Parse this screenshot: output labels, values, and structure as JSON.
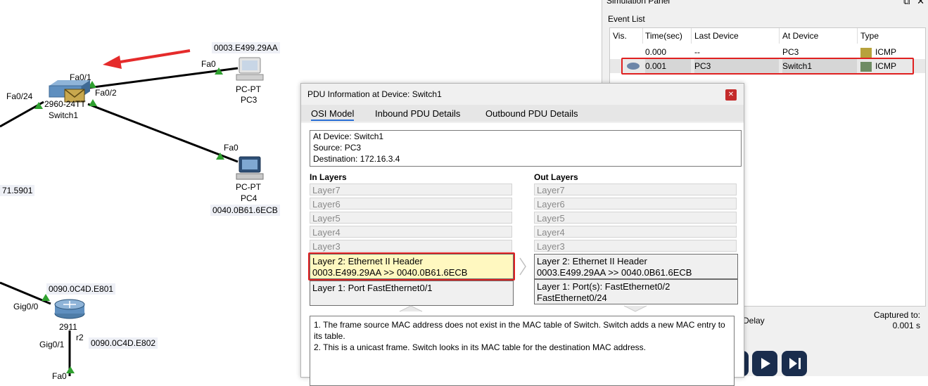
{
  "topology": {
    "mac_pc3": "0003.E499.29AA",
    "mac_pc4": "0040.0B61.6ECB",
    "mac_partial": "71.5901",
    "mac_router1": "0090.0C4D.E801",
    "mac_router2": "0090.0C4D.E802",
    "switch_name": "Switch1",
    "switch_model": "2960-24TT",
    "port_fa01": "Fa0/1",
    "port_fa02": "Fa0/2",
    "port_fa024": "Fa0/24",
    "pc3_type": "PC-PT",
    "pc3_name": "PC3",
    "pc3_port": "Fa0",
    "pc4_type": "PC-PT",
    "pc4_name": "PC4",
    "pc4_port": "Fa0",
    "router_model": "2911",
    "router_name_partial": "r2",
    "router_gig00": "Gig0/0",
    "router_gig01": "Gig0/1",
    "bottom_port_partial": "Fa0"
  },
  "simulation_panel": {
    "title": "Simulation Panel",
    "event_list_label": "Event List",
    "columns": [
      "Vis.",
      "Time(sec)",
      "Last Device",
      "At Device",
      "Type"
    ],
    "events": [
      {
        "vis": "",
        "time": "0.000",
        "last_device": "--",
        "at_device": "PC3",
        "type": "ICMP",
        "color": "#b7a23c"
      },
      {
        "vis": "eye-icon",
        "time": "0.001",
        "last_device": "PC3",
        "at_device": "Switch1",
        "type": "ICMP",
        "color": "#6f8c63"
      }
    ],
    "delay_label": "Delay",
    "captured_label": "Captured to:",
    "captured_value": "0.001 s"
  },
  "pdu_dialog": {
    "title": "PDU Information at Device: Switch1",
    "tabs": [
      "OSI Model",
      "Inbound PDU Details",
      "Outbound PDU Details"
    ],
    "at_device": "At Device: Switch1",
    "source": "Source: PC3",
    "destination": "Destination: 172.16.3.4",
    "in_layers_label": "In Layers",
    "out_layers_label": "Out Layers",
    "in_layers": [
      "Layer7",
      "Layer6",
      "Layer5",
      "Layer4",
      "Layer3"
    ],
    "out_layers": [
      "Layer7",
      "Layer6",
      "Layer5",
      "Layer4",
      "Layer3"
    ],
    "in_layer2_line1": "Layer 2: Ethernet II Header",
    "in_layer2_line2": "0003.E499.29AA >> 0040.0B61.6ECB",
    "out_layer2_line1": "Layer 2: Ethernet II Header",
    "out_layer2_line2": "0003.E499.29AA >> 0040.0B61.6ECB",
    "in_layer1": "Layer 1: Port FastEthernet0/1",
    "out_layer1_line1": "Layer 1: Port(s): FastEthernet0/2",
    "out_layer1_line2": "FastEthernet0/24",
    "description_1": "1. The frame source MAC address does not exist in the MAC table of Switch. Switch adds a new MAC entry to its table.",
    "description_2": "2. This is a unicast frame. Switch looks in its MAC table for the destination MAC address."
  },
  "colors": {
    "highlight_border": "#e02020",
    "layer2_selected_bg": "#fff8c0",
    "link_green": "#2fa02f",
    "play_button": "#1a2d4d"
  }
}
